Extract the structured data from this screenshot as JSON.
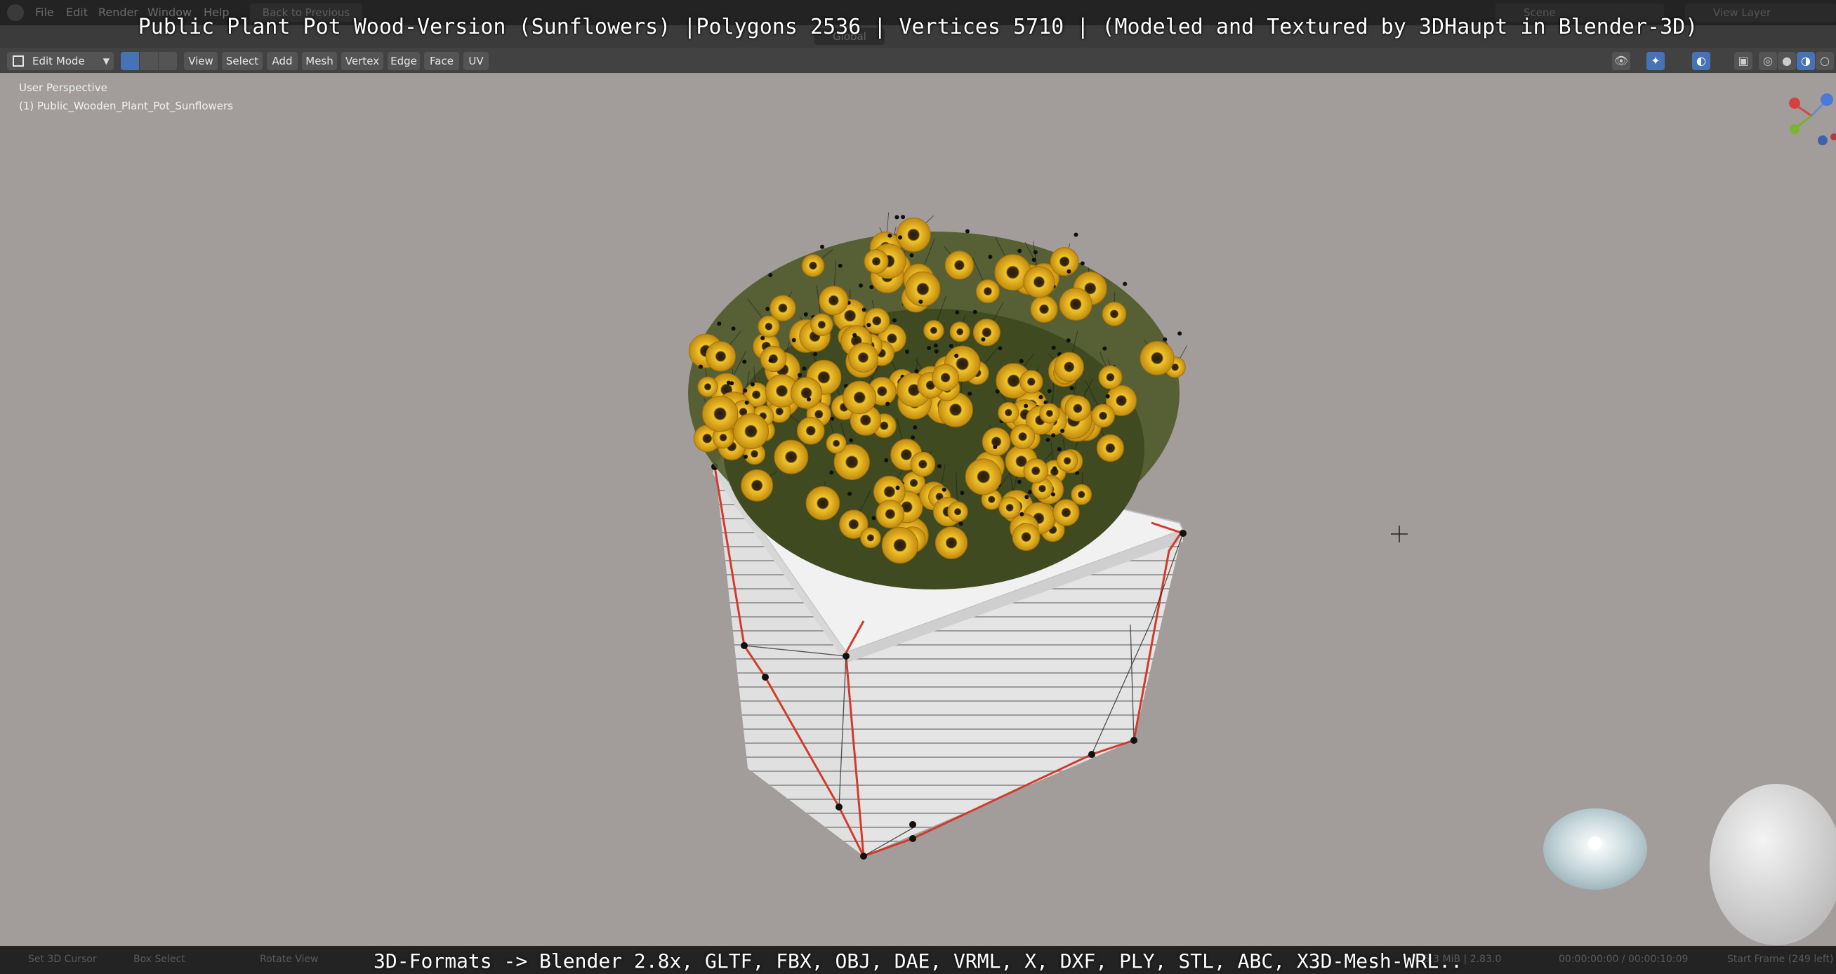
{
  "top_menu": {
    "items": [
      "File",
      "Edit",
      "Render",
      "Window",
      "Help"
    ],
    "back_to_previous": "Back to Previous",
    "scene": "Scene",
    "view_layer": "View Layer"
  },
  "toolbar": {
    "orientation": "Global"
  },
  "video_title": "Public Plant Pot Wood-Version (Sunflowers) |Polygons 2536 | Vertices 5710 | (Modeled and Textured by 3DHaupt in Blender-3D)",
  "header": {
    "mode": "Edit Mode",
    "menus": [
      "View",
      "Select",
      "Add",
      "Mesh",
      "Vertex",
      "Edge",
      "Face",
      "UV"
    ]
  },
  "viewport": {
    "perspective_label": "User Perspective",
    "object_label": "(1) Public_Wooden_Plant_Pot_Sunflowers"
  },
  "statusbar": {
    "left_items": [
      "Set 3D Cursor",
      "Box Select",
      "Rotate View"
    ],
    "right_items": [
      "435.3 MiB | 2.83.0",
      "00:00:00:00 / 00:00:10:09",
      "Start Frame (249 left)"
    ]
  },
  "formats_caption": "3D-Formats -> Blender 2.8x, GLTF, FBX, OBJ, DAE, VRML, X, DXF, PLY, STL, ABC, X3D-Mesh-WRL..",
  "colors": {
    "viewport_bg": "#a29d9b",
    "active_blue": "#4772b3",
    "edge_red": "#d23a2c",
    "sunflower_yellow": "#e8b820"
  }
}
